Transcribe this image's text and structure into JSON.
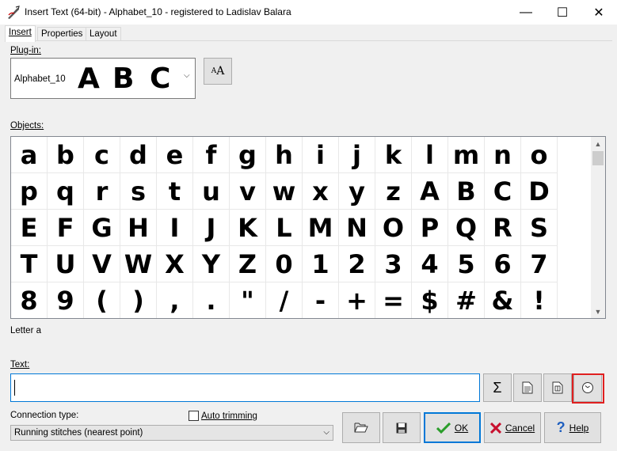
{
  "window": {
    "title": "Insert Text (64-bit) - Alphabet_10 - registered to Ladislav Balara",
    "controls": {
      "minimize": "—",
      "maximize": "☐",
      "close": "✕"
    }
  },
  "tabs": [
    "Insert",
    "Properties",
    "Layout"
  ],
  "plugin": {
    "label": "Plug-in:",
    "selected": "Alphabet_10",
    "preview": [
      "A",
      "B",
      "C"
    ]
  },
  "objects": {
    "label": "Objects:",
    "glyphs": [
      "a",
      "b",
      "c",
      "d",
      "e",
      "f",
      "g",
      "h",
      "i",
      "j",
      "k",
      "l",
      "m",
      "n",
      "o",
      "p",
      "q",
      "r",
      "s",
      "t",
      "u",
      "v",
      "w",
      "x",
      "y",
      "z",
      "A",
      "B",
      "C",
      "D",
      "E",
      "F",
      "G",
      "H",
      "I",
      "J",
      "K",
      "L",
      "M",
      "N",
      "O",
      "P",
      "Q",
      "R",
      "S",
      "T",
      "U",
      "V",
      "W",
      "X",
      "Y",
      "Z",
      "0",
      "1",
      "2",
      "3",
      "4",
      "5",
      "6",
      "7",
      "8",
      "9",
      "(",
      ")",
      ",",
      ".",
      "\"",
      "/",
      "-",
      "+",
      "=",
      "$",
      "#",
      "&",
      "!"
    ]
  },
  "status": "Letter a",
  "text": {
    "label": "Text:",
    "value": ""
  },
  "connection": {
    "label": "Connection type:",
    "selected": "Running stitches (nearest point)"
  },
  "auto_trimming": {
    "label": "Auto trimming",
    "checked": false
  },
  "buttons": {
    "ok": "OK",
    "cancel": "Cancel",
    "help": "Help"
  },
  "icons": {
    "sigma": "Σ",
    "document": "document-icon",
    "doc_settings": "document-settings-icon",
    "clock": "clock-icon",
    "open": "folder-open-icon",
    "save": "save-icon",
    "font": "font-size-icon"
  },
  "colors": {
    "highlight": "#e02020",
    "accent": "#0078d7"
  }
}
